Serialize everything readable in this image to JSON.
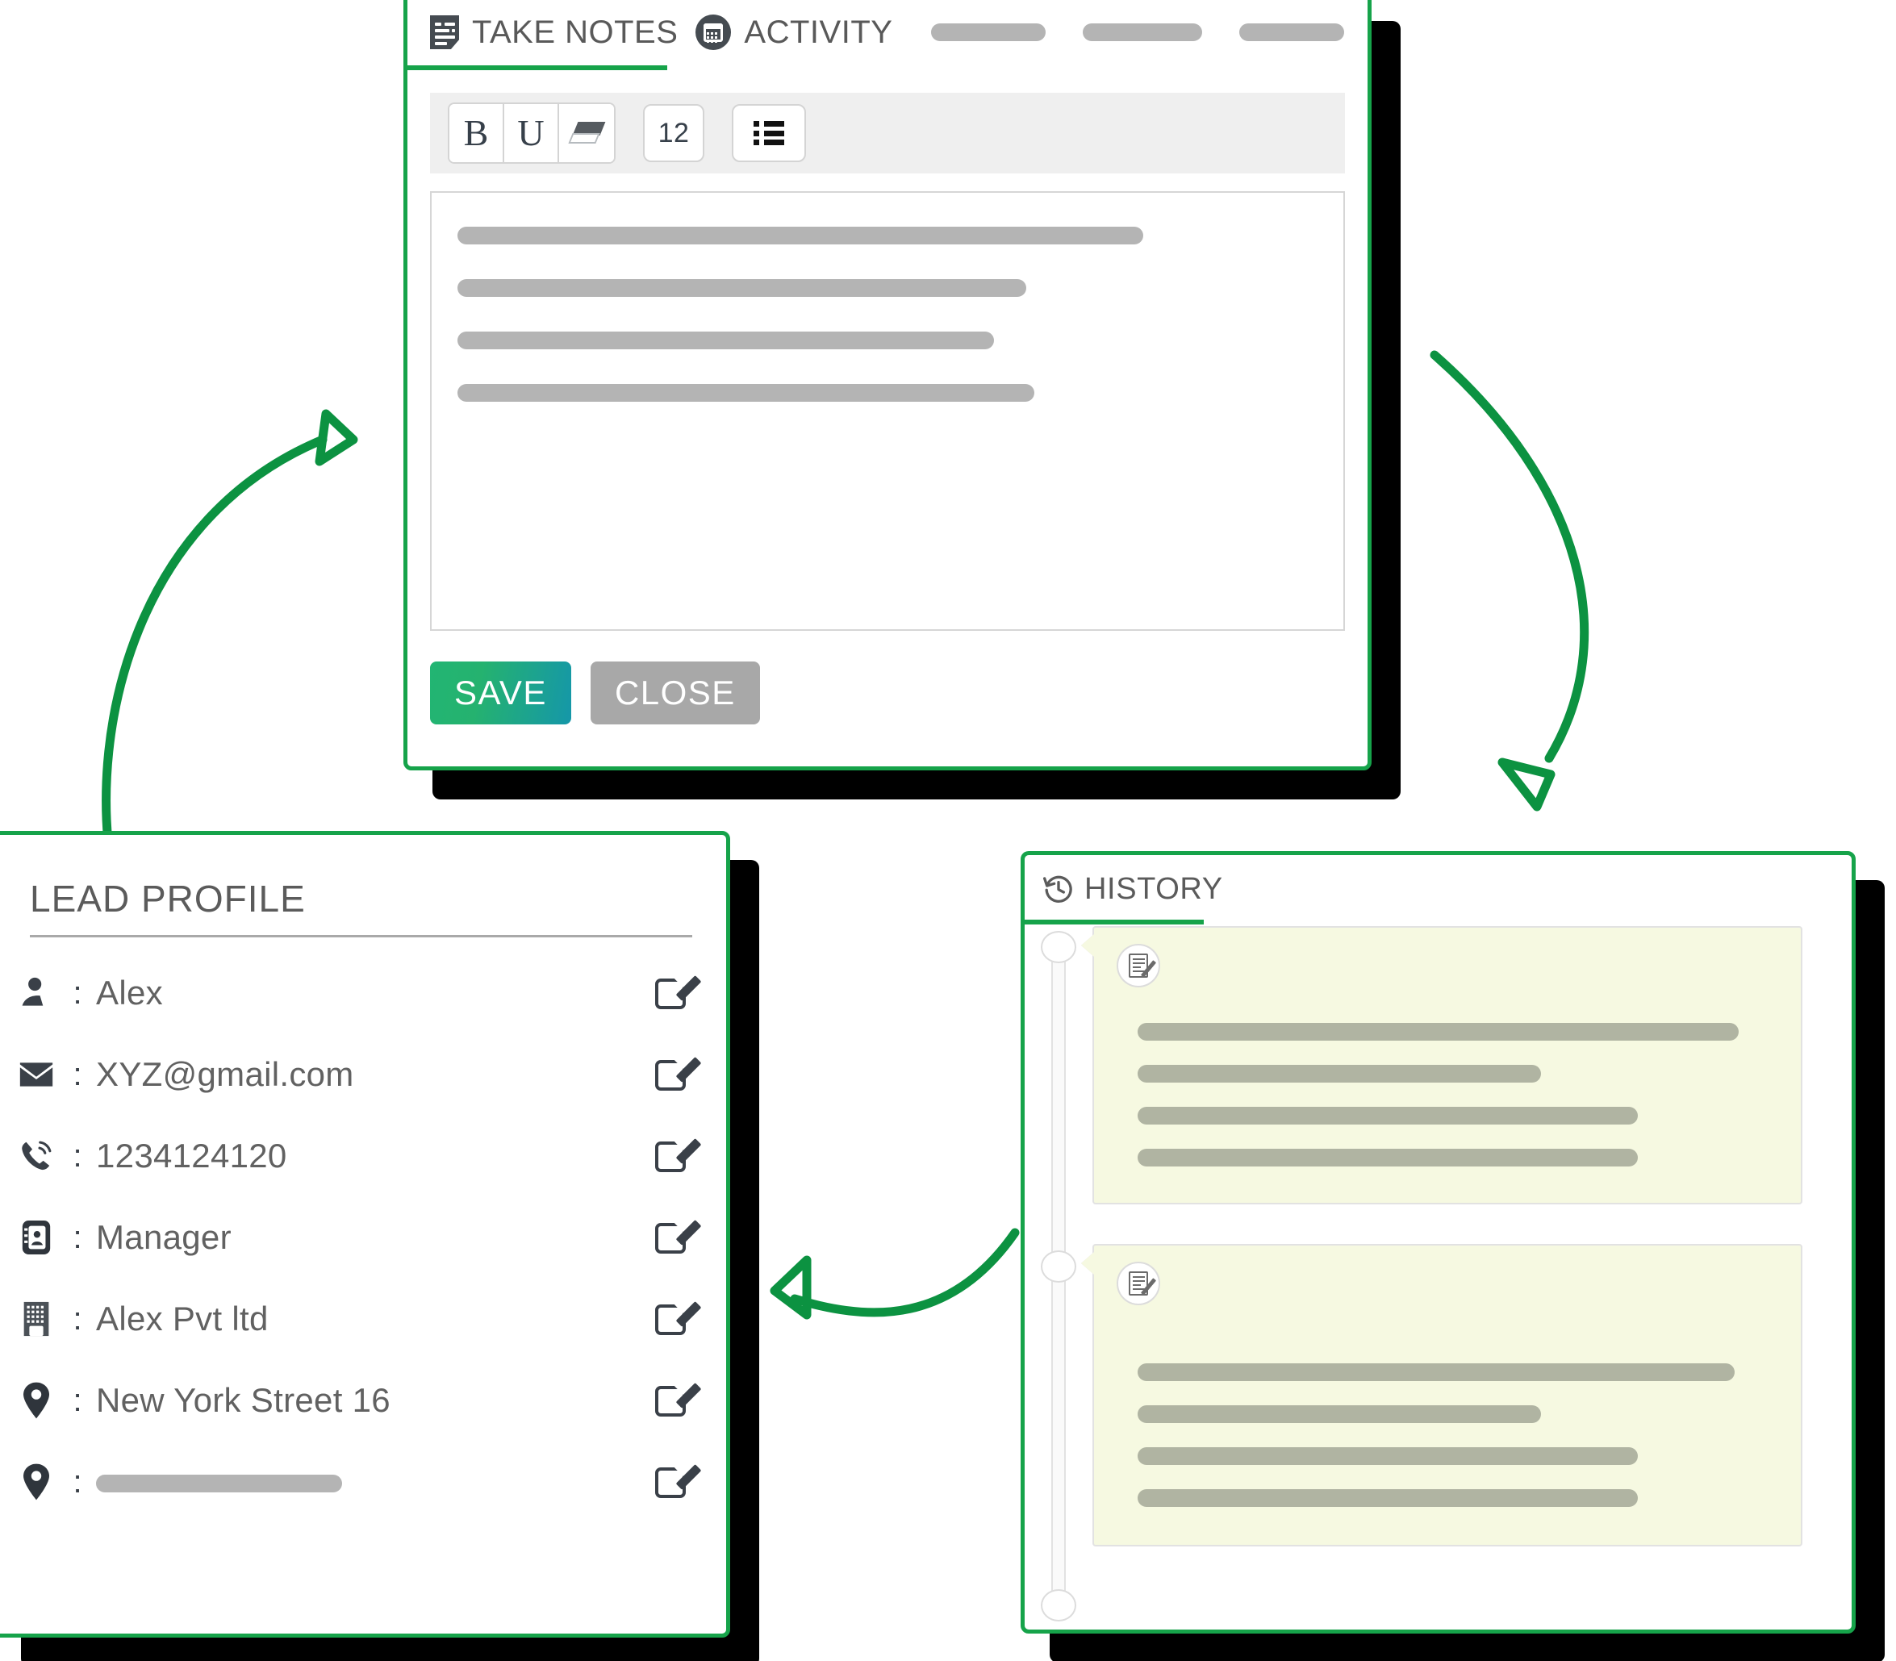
{
  "notes_panel": {
    "tabs": [
      {
        "icon": "note-icon",
        "label": "TAKE NOTES",
        "active": true
      },
      {
        "icon": "calendar-icon",
        "label": "ACTIVITY",
        "active": false
      }
    ],
    "ghost_tabs": [
      {
        "width": 142
      },
      {
        "width": 148
      },
      {
        "width": 130
      }
    ],
    "toolbar": {
      "bold_label": "B",
      "underline_label": "U",
      "eraser_icon": "eraser-icon",
      "font_size_value": "12",
      "list_icon": "bullet-list-icon"
    },
    "editor": {
      "placeholder_lines": [
        850,
        705,
        665,
        715
      ]
    },
    "actions": {
      "save_label": "SAVE",
      "close_label": "CLOSE"
    }
  },
  "lead_panel": {
    "title": "LEAD PROFILE",
    "rows": [
      {
        "icon": "person-icon",
        "separator": ":",
        "value": "Alex",
        "edit_icon": "edit-icon"
      },
      {
        "icon": "envelope-icon",
        "separator": ":",
        "value": "XYZ@gmail.com",
        "edit_icon": "edit-icon"
      },
      {
        "icon": "phone-icon",
        "separator": ":",
        "value": "1234124120",
        "edit_icon": "edit-icon"
      },
      {
        "icon": "contact-card-icon",
        "separator": ":",
        "value": "Manager",
        "edit_icon": "edit-icon"
      },
      {
        "icon": "building-icon",
        "separator": ":",
        "value": "Alex Pvt ltd",
        "edit_icon": "edit-icon"
      },
      {
        "icon": "location-pin-icon",
        "separator": ":",
        "value": "New York Street 16",
        "edit_icon": "edit-icon"
      },
      {
        "icon": "location-pin-icon",
        "separator": ":",
        "value": "",
        "edit_icon": "edit-icon",
        "placeholder_bar": true
      }
    ]
  },
  "history_panel": {
    "tab": {
      "icon": "history-clock-icon",
      "label": "HISTORY",
      "active": true
    },
    "entries": [
      {
        "icon": "note-edit-icon",
        "placeholder_lines": [
          745,
          500,
          620,
          620
        ]
      },
      {
        "icon": "note-edit-icon",
        "placeholder_lines": [
          740,
          500,
          620,
          620
        ]
      }
    ],
    "timeline_markers": 3
  },
  "flow_arrows": [
    {
      "name": "arrow-lead-to-notes",
      "direction": "up-right"
    },
    {
      "name": "arrow-notes-to-history",
      "direction": "down-right"
    },
    {
      "name": "arrow-history-to-lead",
      "direction": "left"
    }
  ],
  "colors": {
    "accent_green": "#16a34a",
    "shadow_black": "#000000",
    "save_gradient_start": "#22b573",
    "save_gradient_end": "#1597a9",
    "close_gray": "#a8a8a8",
    "placeholder_gray": "#b4b4b4",
    "history_card_yellow": "#f6f9e1",
    "text_gray": "#5b5b5b"
  }
}
